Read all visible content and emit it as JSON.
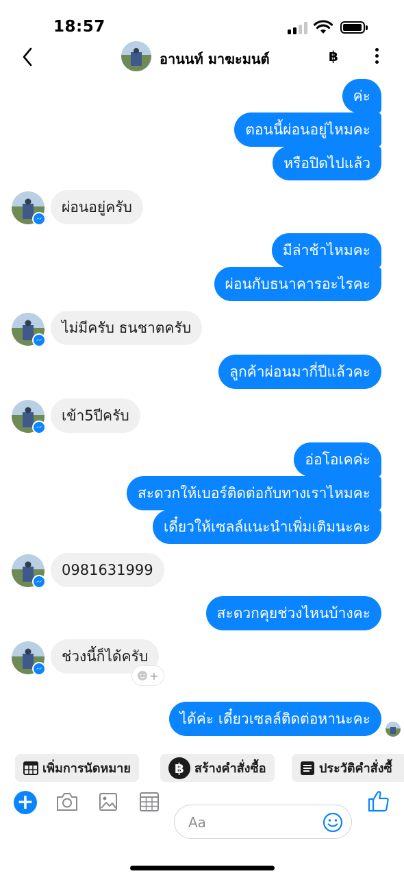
{
  "status_bar": {
    "time": "18:57"
  },
  "header": {
    "contact_name": "อานนท์ มาฆะมนต์",
    "currency_symbol": "฿"
  },
  "messages": [
    {
      "side": "out",
      "text": "ค่ะ"
    },
    {
      "side": "out",
      "text": "ตอนนี้ผ่อนอยู่ไหมคะ"
    },
    {
      "side": "out",
      "text": "หรือปิดไปแล้ว"
    },
    {
      "side": "in",
      "text": "ผ่อนอยู่ครับ"
    },
    {
      "side": "out",
      "text": "มีล่าช้าไหมคะ"
    },
    {
      "side": "out",
      "text": "ผ่อนกับธนาคารอะไรคะ"
    },
    {
      "side": "in",
      "text": "ไม่มีครับ ธนชาตครับ"
    },
    {
      "side": "out",
      "text": "ลูกค้าผ่อนมากี่ปีแล้วคะ"
    },
    {
      "side": "in",
      "text": "เข้า5ปีครับ"
    },
    {
      "side": "out",
      "text": "อ่อโอเคค่ะ"
    },
    {
      "side": "out",
      "text": "สะดวกให้เบอร์ติดต่อกับทางเราไหมคะ"
    },
    {
      "side": "out",
      "text": "เดี๋ยวให้เซลล์แนะนำเพิ่มเติมนะคะ"
    },
    {
      "side": "in",
      "text": "0981631999"
    },
    {
      "side": "out",
      "text": "สะดวกคุยช่วงไหนบ้างคะ"
    },
    {
      "side": "in",
      "text": "ช่วงนี้ก็ได้ครับ"
    },
    {
      "side": "out",
      "text": "ได้ค่ะ เดี๋ยวเซลล์ติดต่อหานะคะ"
    }
  ],
  "quick_actions": [
    {
      "label": "เพิ่มการนัดหมาย",
      "icon": "calendar-icon"
    },
    {
      "label": "สร้างคำสั่งซื้อ",
      "icon": "baht-icon",
      "icon_text": "฿"
    },
    {
      "label": "ประวัติคำสั่งซื้",
      "icon": "receipt-icon"
    }
  ],
  "composer": {
    "placeholder": "Aa"
  },
  "colors": {
    "accent": "#0a84ff",
    "incoming_bubble": "#f0f0f0",
    "chip_bg": "#eeeeee"
  }
}
